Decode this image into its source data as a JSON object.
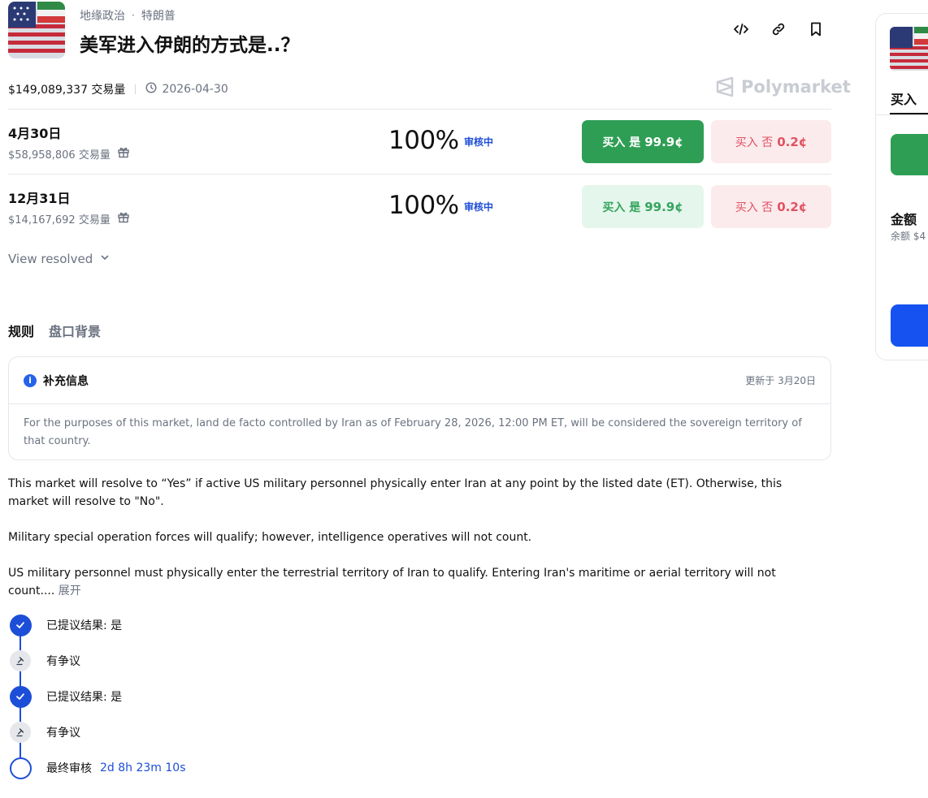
{
  "header": {
    "breadcrumb": [
      "地缘政治",
      "特朗普"
    ],
    "breadcrumb_separator": "·",
    "title": "美军进入伊朗的方式是..？",
    "actions": [
      "embed-icon",
      "link-icon",
      "bookmark-icon"
    ]
  },
  "stats": {
    "volume": "$149,089,337 交易量",
    "date": "2026-04-30",
    "brand": "Polymarket"
  },
  "outcomes": [
    {
      "name": "4月30日",
      "volume": "$58,958,806 交易量",
      "percent": "100%",
      "status": "审核中",
      "yes_label": "买入 是",
      "yes_price": "99.9¢",
      "no_label": "买入 否",
      "no_price": "0.2¢"
    },
    {
      "name": "12月31日",
      "volume": "$14,167,692 交易量",
      "percent": "100%",
      "status": "审核中",
      "yes_label": "买入 是",
      "yes_price": "99.9¢",
      "no_label": "买入 否",
      "no_price": "0.2¢"
    }
  ],
  "view_resolved": "View resolved",
  "tabs": [
    "规则",
    "盘口背景"
  ],
  "info_card": {
    "title": "补充信息",
    "updated": "更新于 3月20日",
    "body": "For the purposes of this market, land de facto controlled by Iran as of February 28, 2026, 12:00 PM ET, will be considered the sovereign territory of that country."
  },
  "rules": {
    "p1": "This market will resolve to “Yes” if active US military personnel physically enter Iran at any point by the listed date (ET). Otherwise, this market will resolve to \"No\".",
    "p2": "Military special operation forces will qualify; however, intelligence operatives will not count.",
    "p3": "US military personnel must physically enter the terrestrial territory of Iran to qualify. Entering Iran's maritime or aerial territory will not count....",
    "more": "展开"
  },
  "timeline": [
    {
      "label": "已提议结果: 是",
      "type": "check"
    },
    {
      "label": "有争议",
      "type": "dispute"
    },
    {
      "label": "已提议结果: 是",
      "type": "check"
    },
    {
      "label": "有争议",
      "type": "dispute"
    },
    {
      "label": "最终审核",
      "type": "open",
      "timer": "2d 8h 23m 10s"
    }
  ],
  "side_panel": {
    "tab": "买入",
    "amount_label": "金额",
    "balance": "余额 $4"
  },
  "colors": {
    "accent_blue": "#1d4ed8",
    "yes_green": "#2f9e55",
    "no_red": "#e05262"
  }
}
